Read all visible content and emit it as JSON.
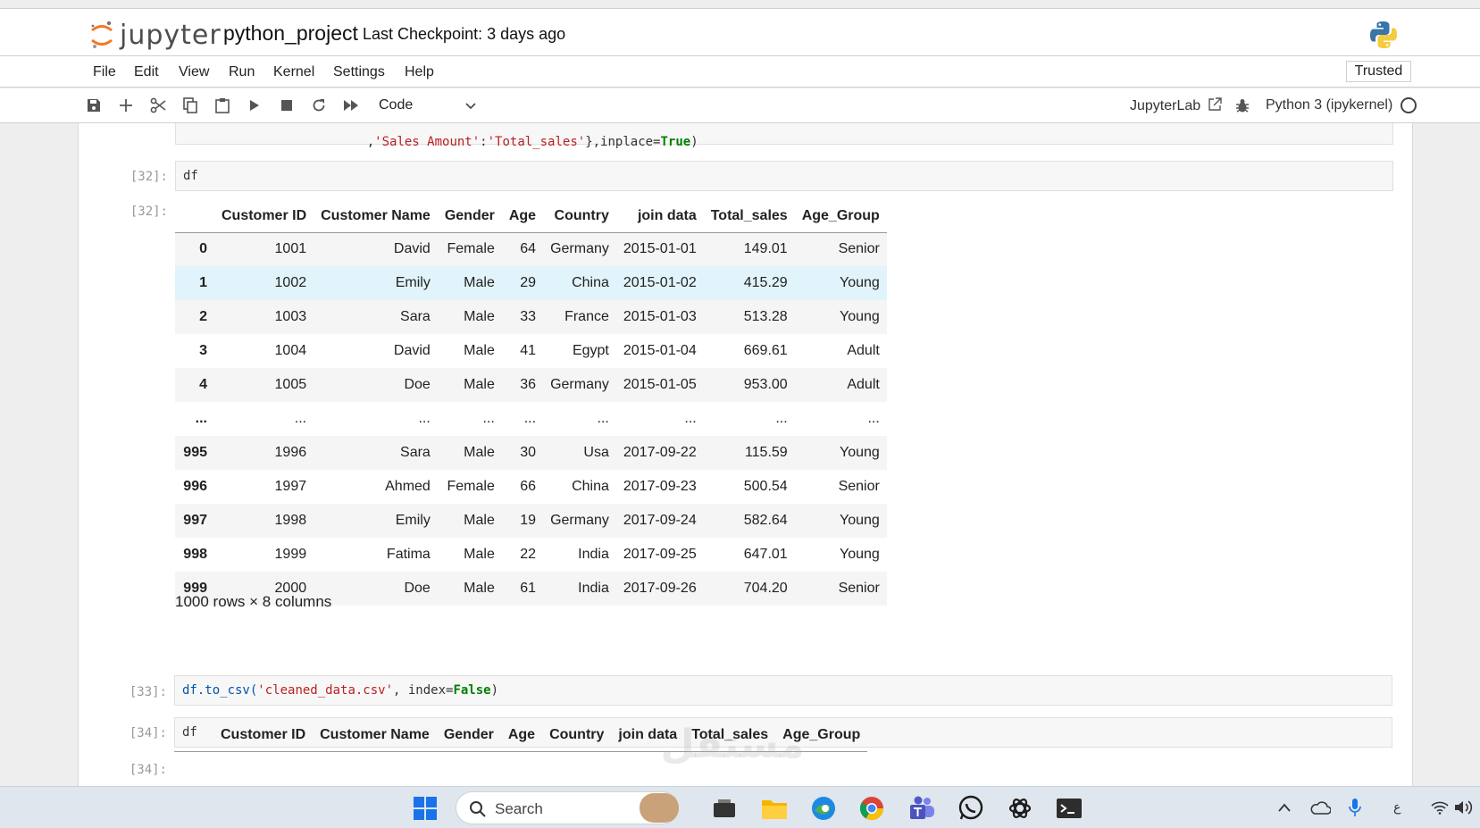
{
  "header": {
    "logo_text": "jupyter",
    "notebook_title": "python_project",
    "checkpoint": "Last Checkpoint: 3 days ago"
  },
  "menu": {
    "items": [
      "File",
      "Edit",
      "View",
      "Run",
      "Kernel",
      "Settings",
      "Help"
    ],
    "trusted": "Trusted"
  },
  "toolbar": {
    "cell_type": "Code",
    "jupyterlab_link": "JupyterLab",
    "kernel_name": "Python 3 (ipykernel)"
  },
  "cells": {
    "prev_code_tail": ",'Sales Amount':'Total_sales'},inplace=True)",
    "cell32": {
      "in_prompt": "[32]:",
      "code": "df",
      "out_prompt": "[32]:"
    },
    "cell33": {
      "in_prompt": "[33]:",
      "code_fn": "df.to_csv(",
      "code_str": "'cleaned_data.csv'",
      "code_mid": ", index=",
      "code_kw": "False",
      "code_end": ")"
    },
    "cell34": {
      "in_prompt": "[34]:",
      "code": "df",
      "out_prompt": "[34]:"
    }
  },
  "dataframe": {
    "columns": [
      "",
      "Customer ID",
      "Customer Name",
      "Gender",
      "Age",
      "Country",
      "join data",
      "Total_sales",
      "Age_Group"
    ],
    "rows": [
      [
        "0",
        "1001",
        "David",
        "Female",
        "64",
        "Germany",
        "2015-01-01",
        "149.01",
        "Senior"
      ],
      [
        "1",
        "1002",
        "Emily",
        "Male",
        "29",
        "China",
        "2015-01-02",
        "415.29",
        "Young"
      ],
      [
        "2",
        "1003",
        "Sara",
        "Male",
        "33",
        "France",
        "2015-01-03",
        "513.28",
        "Young"
      ],
      [
        "3",
        "1004",
        "David",
        "Male",
        "41",
        "Egypt",
        "2015-01-04",
        "669.61",
        "Adult"
      ],
      [
        "4",
        "1005",
        "Doe",
        "Male",
        "36",
        "Germany",
        "2015-01-05",
        "953.00",
        "Adult"
      ],
      [
        "...",
        "...",
        "...",
        "...",
        "...",
        "...",
        "...",
        "...",
        "..."
      ],
      [
        "995",
        "1996",
        "Sara",
        "Male",
        "30",
        "Usa",
        "2017-09-22",
        "115.59",
        "Young"
      ],
      [
        "996",
        "1997",
        "Ahmed",
        "Female",
        "66",
        "China",
        "2017-09-23",
        "500.54",
        "Senior"
      ],
      [
        "997",
        "1998",
        "Emily",
        "Male",
        "19",
        "Germany",
        "2017-09-24",
        "582.64",
        "Young"
      ],
      [
        "998",
        "1999",
        "Fatima",
        "Male",
        "22",
        "India",
        "2017-09-25",
        "647.01",
        "Young"
      ],
      [
        "999",
        "2000",
        "Doe",
        "Male",
        "61",
        "India",
        "2017-09-26",
        "704.20",
        "Senior"
      ]
    ],
    "shape_text": "1000 rows × 8 columns",
    "hovered_row": 1
  },
  "taskbar": {
    "search_label": "Search",
    "tray_lang": "ع",
    "icons": [
      "windows-start-icon",
      "search-icon",
      "photos-icon",
      "task-view-icon",
      "file-explorer-icon",
      "edge-icon",
      "chrome-icon",
      "teams-icon",
      "whatsapp-icon",
      "chatgpt-icon",
      "terminal-icon"
    ]
  },
  "watermark": "مستقل"
}
